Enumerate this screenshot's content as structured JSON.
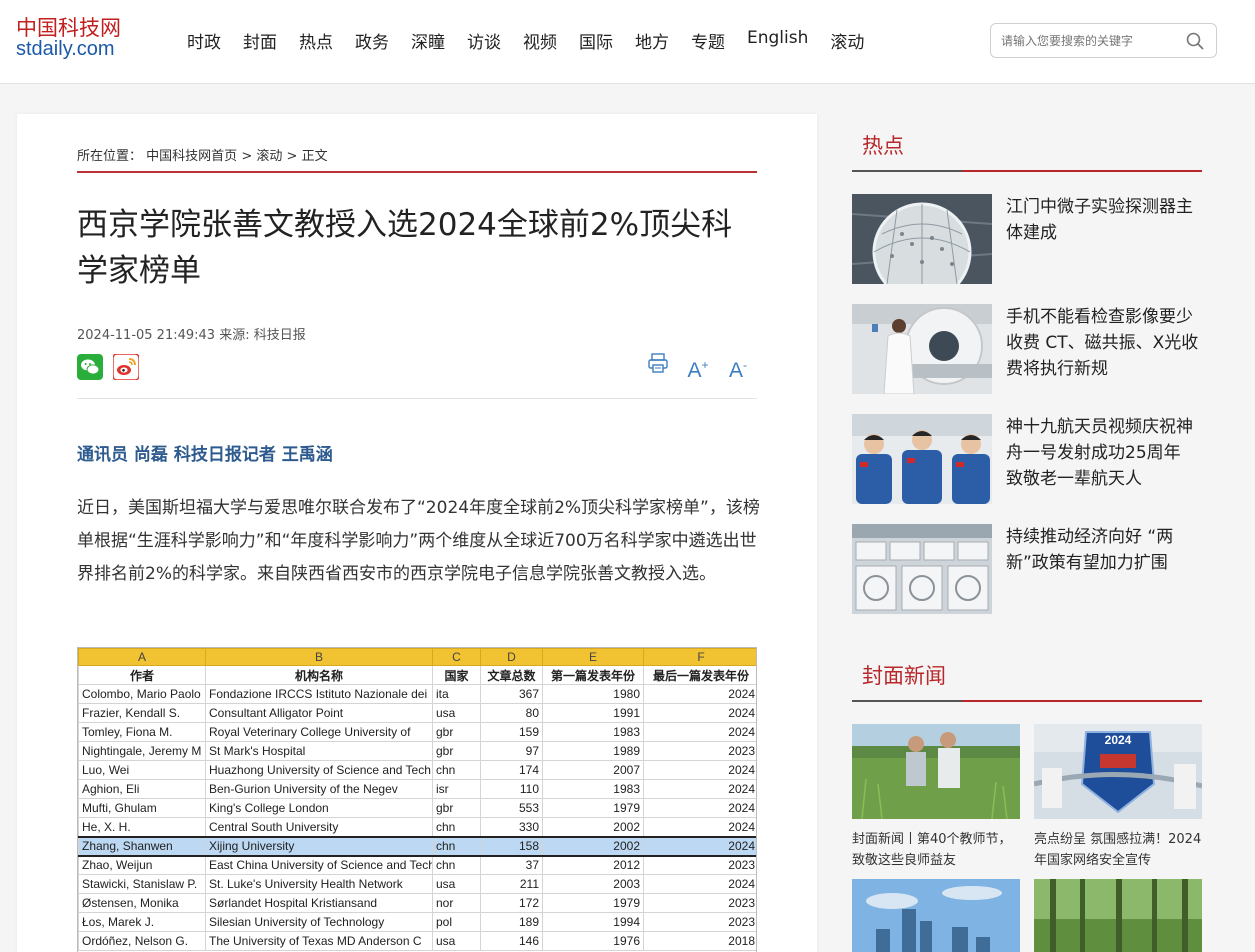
{
  "logo": {
    "cn": "中国科技网",
    "en": "stdaily.com"
  },
  "nav": [
    "时政",
    "封面",
    "热点",
    "政务",
    "深瞳",
    "访谈",
    "视频",
    "国际",
    "地方",
    "专题",
    "English",
    "滚动"
  ],
  "search": {
    "placeholder": "请输入您要搜索的关键字",
    "icon": "search-icon"
  },
  "breadcrumb": {
    "prefix": "所在位置：",
    "items": [
      "中国科技网首页",
      "滚动",
      "正文"
    ],
    "separator": ">"
  },
  "article": {
    "title": "西京学院张善文教授入选2024全球前2%顶尖科学家榜单",
    "meta": "2024-11-05 21:49:43 来源: 科技日报",
    "share_icons": [
      "wechat-icon",
      "weibo-icon"
    ],
    "tool_icons": [
      "print-icon",
      "font-increase-icon",
      "font-decrease-icon"
    ],
    "tools": {
      "increase": "A",
      "increase_sup": "+",
      "decrease": "A",
      "decrease_sup": "-"
    },
    "byline": "通讯员 尚磊 科技日报记者 王禹涵",
    "paragraph": "近日，美国斯坦福大学与爱思唯尔联合发布了“2024年度全球前2%顶尖科学家榜单”，该榜单根据“生涯科学影响力”和“年度科学影响力”两个维度从全球近700万名科学家中遴选出世界排名前2%的科学家。来自陕西省西安市的西京学院电子信息学院张善文教授入选。"
  },
  "sheet": {
    "col_letters": [
      "A",
      "B",
      "C",
      "D",
      "E",
      "F"
    ],
    "headers": [
      "作者",
      "机构名称",
      "国家",
      "文章总数",
      "第一篇发表年份",
      "最后一篇发表年份"
    ],
    "rows": [
      [
        "Colombo, Mario Paolo",
        "Fondazione IRCCS Istituto Nazionale dei",
        "ita",
        "367",
        "1980",
        "2024"
      ],
      [
        "Frazier, Kendall S.",
        "Consultant Alligator Point",
        "usa",
        "80",
        "1991",
        "2024"
      ],
      [
        "Tomley, Fiona M.",
        "Royal Veterinary College University of",
        "gbr",
        "159",
        "1983",
        "2024"
      ],
      [
        "Nightingale, Jeremy M",
        "St Mark's Hospital",
        "gbr",
        "97",
        "1989",
        "2023"
      ],
      [
        "Luo, Wei",
        "Huazhong University of Science and Tech",
        "chn",
        "174",
        "2007",
        "2024"
      ],
      [
        "Aghion, Eli",
        "Ben-Gurion University of the Negev",
        "isr",
        "110",
        "1983",
        "2024"
      ],
      [
        "Mufti, Ghulam",
        "King's College London",
        "gbr",
        "553",
        "1979",
        "2024"
      ],
      [
        "He, X. H.",
        "Central South University",
        "chn",
        "330",
        "2002",
        "2024"
      ],
      [
        "Zhang, Shanwen",
        "Xijing University",
        "chn",
        "158",
        "2002",
        "2024"
      ],
      [
        "Zhao, Weijun",
        "East China University of Science and Tech",
        "chn",
        "37",
        "2012",
        "2023"
      ],
      [
        "Stawicki, Stanislaw P.",
        "St. Luke's University Health Network",
        "usa",
        "211",
        "2003",
        "2024"
      ],
      [
        "Østensen, Monika",
        "Sørlandet Hospital Kristiansand",
        "nor",
        "172",
        "1979",
        "2023"
      ],
      [
        "Łos, Marek J.",
        "Silesian University of Technology",
        "pol",
        "189",
        "1994",
        "2023"
      ],
      [
        "Ordóñez, Nelson G.",
        "The University of Texas MD Anderson C",
        "usa",
        "146",
        "1976",
        "2018"
      ]
    ],
    "highlight_index": 8
  },
  "sidebar": {
    "hot_title": "热点",
    "hot_items": [
      {
        "text": "江门中微子实验探测器主体建成",
        "thumb": "detector-sphere-image"
      },
      {
        "text": "手机不能看检查影像要少收费 CT、磁共振、X光收费将执行新规",
        "thumb": "ct-scanner-image"
      },
      {
        "text": "神十九航天员视频庆祝神舟一号发射成功25周年 致敬老一辈航天人",
        "thumb": "astronauts-image"
      },
      {
        "text": "持续推动经济向好 “两新”政策有望加力扩围",
        "thumb": "air-conditioners-image"
      }
    ],
    "cover_title": "封面新闻",
    "cover_items": [
      {
        "text": "封面新闻丨第40个教师节，致敬这些良师益友",
        "thumb": "field-teachers-image"
      },
      {
        "text": "亮点纷呈 氛围感拉满！2024年国家网络安全宣传",
        "thumb": "cyber-week-image",
        "badge": "2024"
      },
      {
        "text": "",
        "thumb": "city-skyline-image"
      },
      {
        "text": "",
        "thumb": "forest-image"
      }
    ]
  },
  "colors": {
    "accent": "#b8282b",
    "link_blue": "#2e5b8f",
    "tool_blue": "#3c7ec2",
    "sheet_header": "#f1c232",
    "highlight": "#bcd8f2"
  }
}
